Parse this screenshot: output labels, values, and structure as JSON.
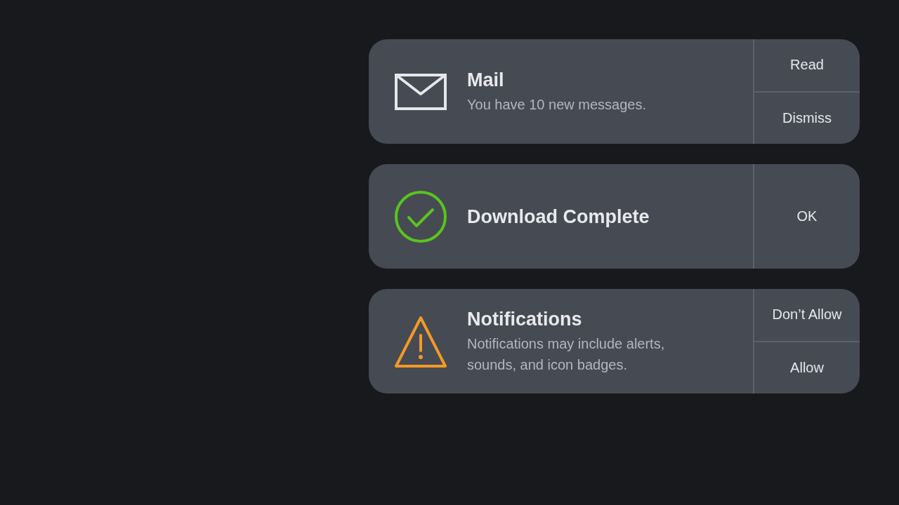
{
  "notifications": [
    {
      "kind": "mail",
      "title": "Mail",
      "message": "You have 10 new messages.",
      "actions": [
        "Read",
        "Dismiss"
      ]
    },
    {
      "kind": "success",
      "title": "Download Complete",
      "actions": [
        "OK"
      ]
    },
    {
      "kind": "warning",
      "title": "Notifications",
      "message": "Notifications may include alerts, sounds, and icon badges.",
      "actions": [
        "Don’t Allow",
        "Allow"
      ]
    }
  ]
}
